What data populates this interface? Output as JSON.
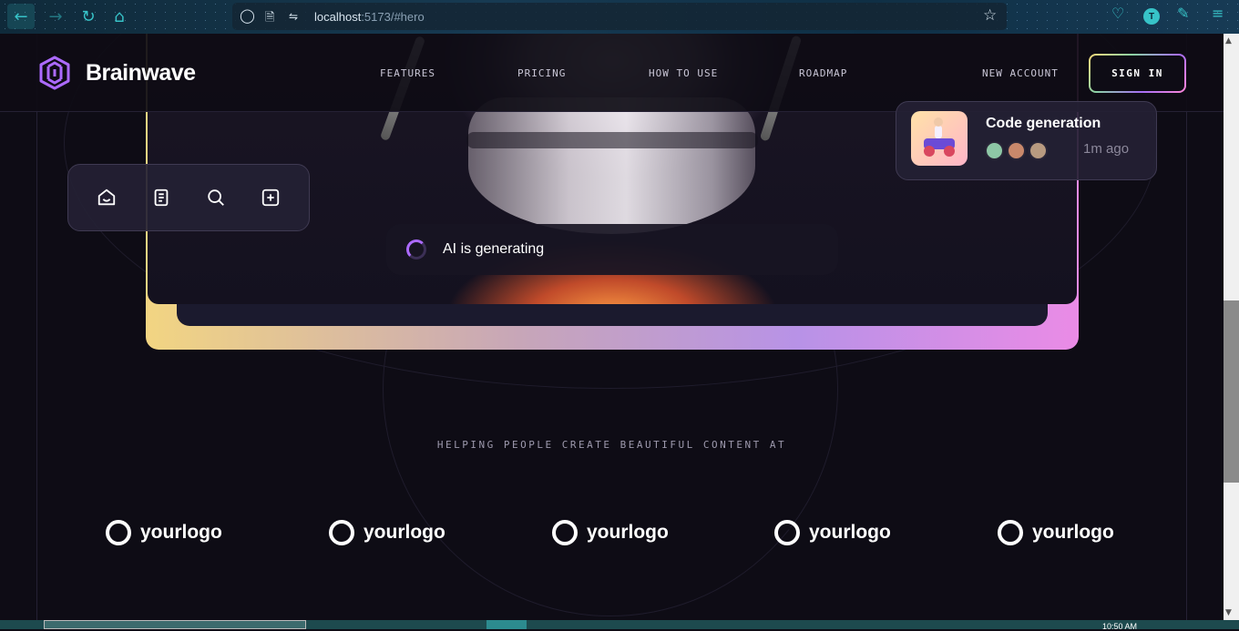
{
  "browser": {
    "url_host": "localhost",
    "url_rest": ":5173/#hero",
    "profile_initial": "T"
  },
  "header": {
    "brand": "Brainwave",
    "nav": [
      "FEATURES",
      "PRICING",
      "HOW TO USE",
      "ROADMAP"
    ],
    "new_account": "NEW ACCOUNT",
    "sign_in": "SIGN IN"
  },
  "hero": {
    "generating_text": "AI is generating",
    "icons": [
      "home-icon",
      "file-icon",
      "search-icon",
      "plus-square-icon"
    ]
  },
  "notification": {
    "title": "Code generation",
    "time": "1m ago"
  },
  "companies": {
    "caption": "HELPING PEOPLE CREATE BEAUTIFUL CONTENT AT",
    "logos": [
      "yourlogo",
      "yourlogo",
      "yourlogo",
      "yourlogo",
      "yourlogo"
    ]
  },
  "taskbar": {
    "clock": "10:50 AM"
  },
  "colors": {
    "background": "#0e0c15",
    "accent_purple": "#ac6aff",
    "accent_teal": "#37c3c8"
  }
}
